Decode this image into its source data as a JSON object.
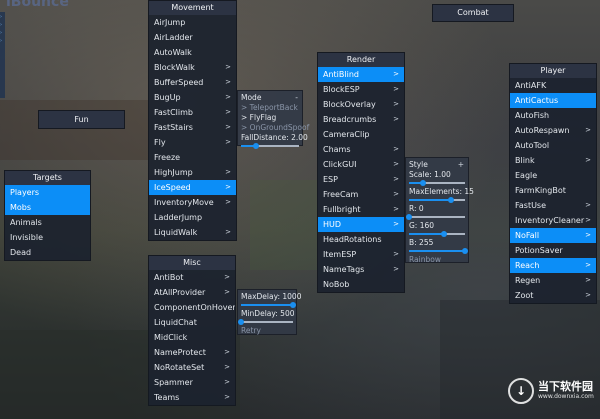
{
  "logo_text": "iBounce",
  "panels": {
    "movement": {
      "title": "Movement",
      "items": [
        {
          "label": "AirJump",
          "arrow": "",
          "active": false
        },
        {
          "label": "AirLadder",
          "arrow": "",
          "active": false
        },
        {
          "label": "AutoWalk",
          "arrow": "",
          "active": false
        },
        {
          "label": "BlockWalk",
          "arrow": ">",
          "active": false
        },
        {
          "label": "BufferSpeed",
          "arrow": ">",
          "active": false
        },
        {
          "label": "BugUp",
          "arrow": ">",
          "active": false
        },
        {
          "label": "FastClimb",
          "arrow": ">",
          "active": false
        },
        {
          "label": "FastStairs",
          "arrow": ">",
          "active": false
        },
        {
          "label": "Fly",
          "arrow": ">",
          "active": false
        },
        {
          "label": "Freeze",
          "arrow": "",
          "active": false
        },
        {
          "label": "HighJump",
          "arrow": ">",
          "active": false
        },
        {
          "label": "IceSpeed",
          "arrow": ">",
          "active": true
        },
        {
          "label": "InventoryMove",
          "arrow": ">",
          "active": false
        },
        {
          "label": "LadderJump",
          "arrow": "",
          "active": false
        },
        {
          "label": "LiquidWalk",
          "arrow": ">",
          "active": false
        }
      ]
    },
    "combat": {
      "title": "Combat"
    },
    "fun": {
      "title": "Fun"
    },
    "targets": {
      "title": "Targets",
      "items": [
        {
          "label": "Players",
          "arrow": "",
          "active": true
        },
        {
          "label": "Mobs",
          "arrow": "",
          "active": true
        },
        {
          "label": "Animals",
          "arrow": "",
          "active": false
        },
        {
          "label": "Invisible",
          "arrow": "",
          "active": false
        },
        {
          "label": "Dead",
          "arrow": "",
          "active": false
        }
      ]
    },
    "render": {
      "title": "Render",
      "items": [
        {
          "label": "AntiBlind",
          "arrow": ">",
          "active": true
        },
        {
          "label": "BlockESP",
          "arrow": ">",
          "active": false
        },
        {
          "label": "BlockOverlay",
          "arrow": ">",
          "active": false
        },
        {
          "label": "Breadcrumbs",
          "arrow": ">",
          "active": false
        },
        {
          "label": "CameraClip",
          "arrow": "",
          "active": false
        },
        {
          "label": "Chams",
          "arrow": ">",
          "active": false
        },
        {
          "label": "ClickGUI",
          "arrow": ">",
          "active": false
        },
        {
          "label": "ESP",
          "arrow": ">",
          "active": false
        },
        {
          "label": "FreeCam",
          "arrow": ">",
          "active": false
        },
        {
          "label": "Fullbright",
          "arrow": ">",
          "active": false
        },
        {
          "label": "HUD",
          "arrow": ">",
          "active": true
        },
        {
          "label": "HeadRotations",
          "arrow": "",
          "active": false
        },
        {
          "label": "ItemESP",
          "arrow": ">",
          "active": false
        },
        {
          "label": "NameTags",
          "arrow": ">",
          "active": false
        },
        {
          "label": "NoBob",
          "arrow": "",
          "active": false
        }
      ]
    },
    "player": {
      "title": "Player",
      "items": [
        {
          "label": "AntiAFK",
          "arrow": "",
          "active": false
        },
        {
          "label": "AntiCactus",
          "arrow": "",
          "active": true
        },
        {
          "label": "AutoFish",
          "arrow": "",
          "active": false
        },
        {
          "label": "AutoRespawn",
          "arrow": ">",
          "active": false
        },
        {
          "label": "AutoTool",
          "arrow": "",
          "active": false
        },
        {
          "label": "Blink",
          "arrow": ">",
          "active": false
        },
        {
          "label": "Eagle",
          "arrow": "",
          "active": false
        },
        {
          "label": "FarmKingBot",
          "arrow": "",
          "active": false
        },
        {
          "label": "FastUse",
          "arrow": ">",
          "active": false
        },
        {
          "label": "InventoryCleaner",
          "arrow": ">",
          "active": false
        },
        {
          "label": "NoFall",
          "arrow": ">",
          "active": true
        },
        {
          "label": "PotionSaver",
          "arrow": "",
          "active": false
        },
        {
          "label": "Reach",
          "arrow": ">",
          "active": true
        },
        {
          "label": "Regen",
          "arrow": ">",
          "active": false
        },
        {
          "label": "Zoot",
          "arrow": ">",
          "active": false
        }
      ]
    },
    "misc": {
      "title": "Misc",
      "items": [
        {
          "label": "AntiBot",
          "arrow": ">",
          "active": false
        },
        {
          "label": "AtAllProvider",
          "arrow": ">",
          "active": false
        },
        {
          "label": "ComponentOnHover",
          "arrow": "",
          "active": false
        },
        {
          "label": "LiquidChat",
          "arrow": "",
          "active": false
        },
        {
          "label": "MidClick",
          "arrow": "",
          "active": false
        },
        {
          "label": "NameProtect",
          "arrow": ">",
          "active": false
        },
        {
          "label": "NoRotateSet",
          "arrow": ">",
          "active": false
        },
        {
          "label": "Spammer",
          "arrow": ">",
          "active": false
        },
        {
          "label": "Teams",
          "arrow": ">",
          "active": false
        }
      ]
    }
  },
  "settings": {
    "icespeed": {
      "mode_label": "Mode",
      "mode_sign": "-",
      "options": [
        "> TeleportBack",
        "> FlyFlag",
        "> OnGroundSpoof"
      ],
      "fall_distance_label": "FallDistance: 2.00",
      "fall_distance_fraction": 0.25
    },
    "hud": {
      "style_label": "Style",
      "style_sign": "+",
      "scale_label": "Scale: 1.00",
      "scale_fraction": 0.25,
      "max_elements_label": "MaxElements: 15",
      "max_elements_fraction": 0.75,
      "r_label": "R: 0",
      "r_fraction": 0.0,
      "g_label": "G: 160",
      "g_fraction": 0.63,
      "b_label": "B: 255",
      "b_fraction": 1.0,
      "rainbow_label": "Rainbow"
    },
    "antibot": {
      "max_delay_label": "MaxDelay: 1000",
      "max_delay_fraction": 1.0,
      "min_delay_label": "MinDelay: 500",
      "min_delay_fraction": 0.0,
      "retry_label": "Retry"
    }
  },
  "watermark": {
    "icon_glyph": "↓",
    "title": "当下软件园",
    "url": "www.downxia.com"
  },
  "colors": {
    "accent": "#0c8ef7",
    "panel_bg": "#1c222e",
    "header_bg": "#2c3444",
    "settings_bg": "#323a46"
  }
}
